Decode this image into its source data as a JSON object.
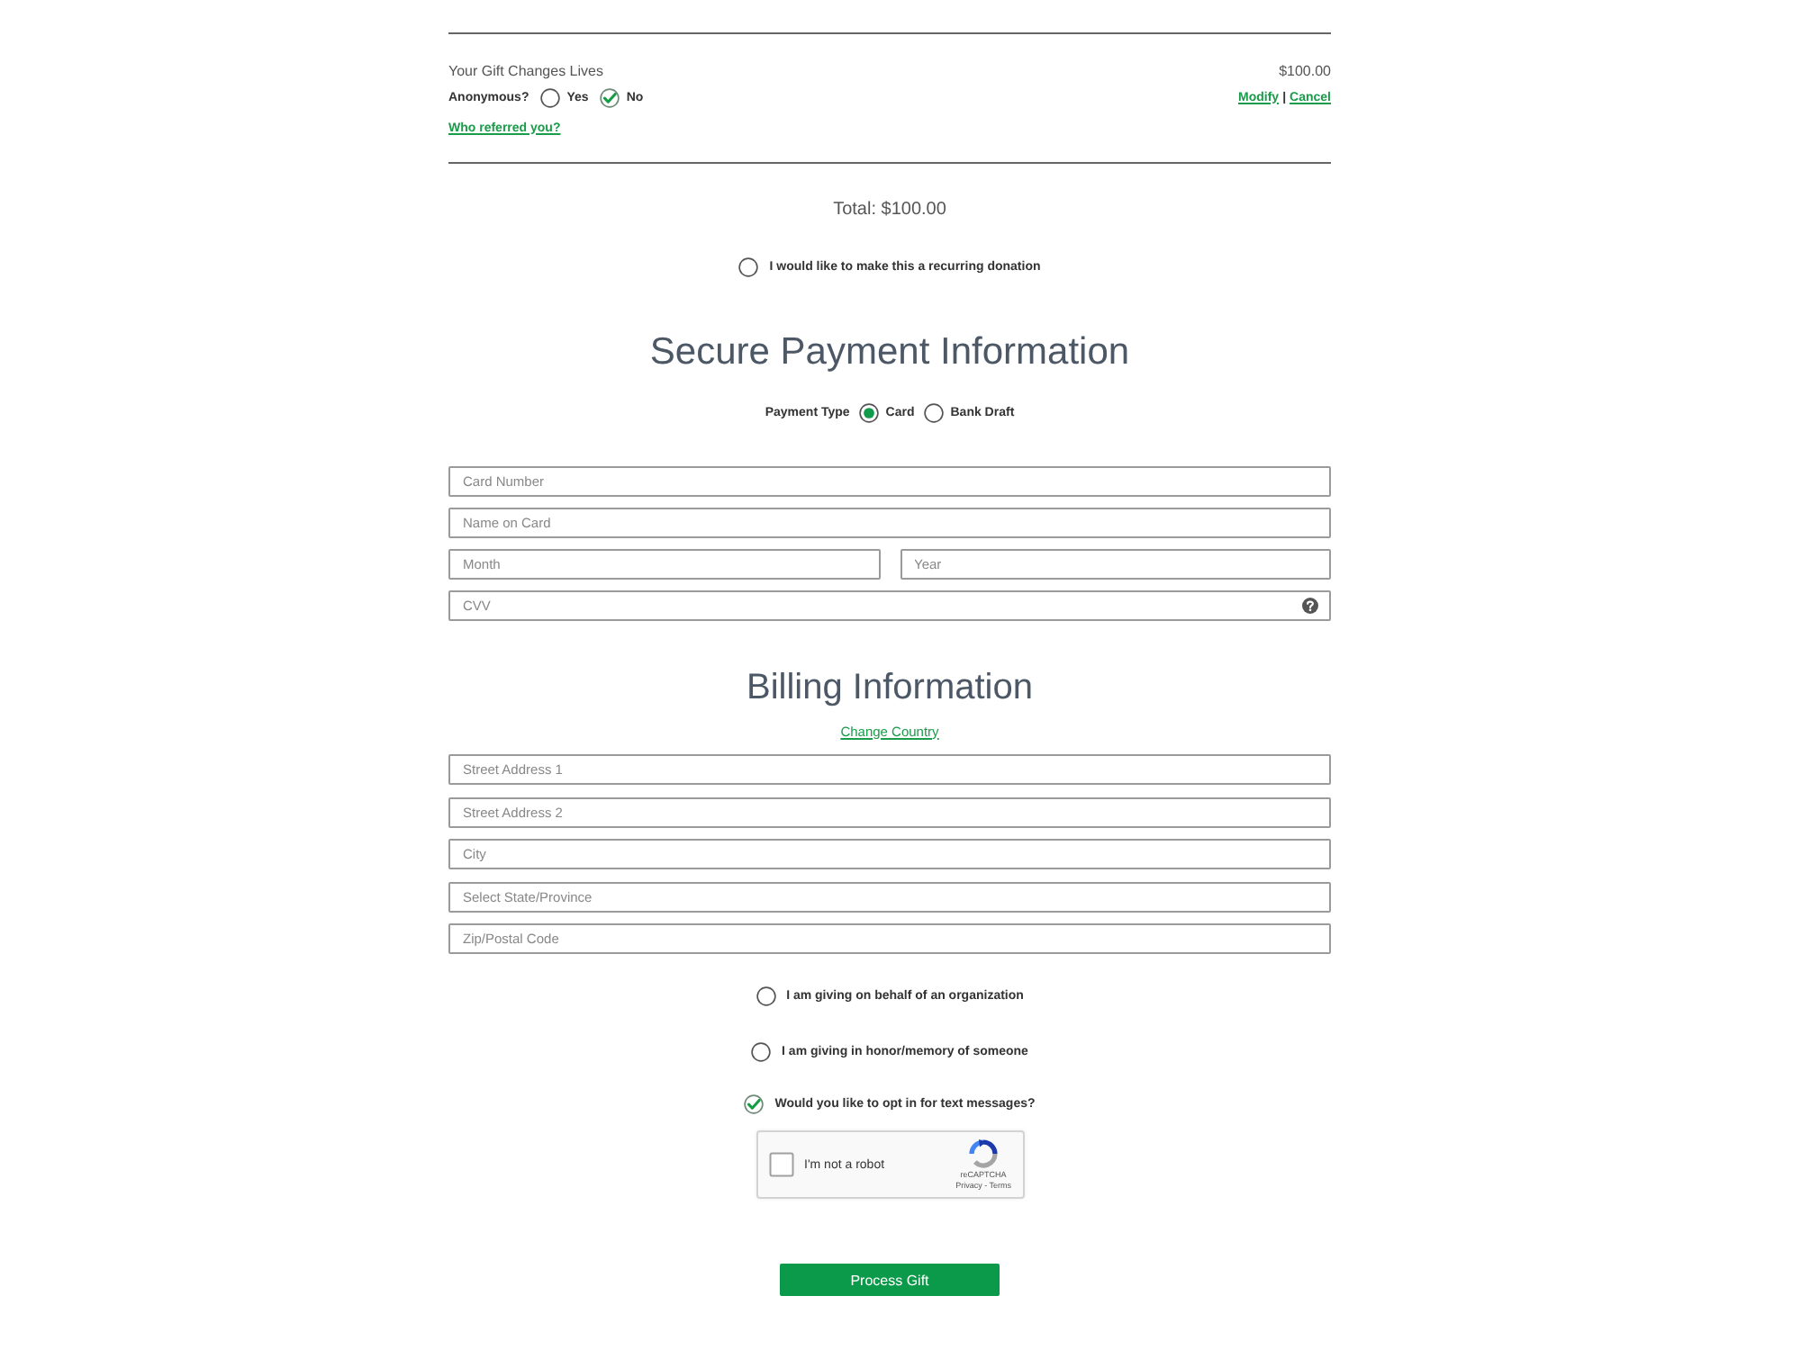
{
  "gift_summary": {
    "title": "Your Gift Changes Lives",
    "amount": "$100.00",
    "anonymous": {
      "label": "Anonymous?",
      "options": [
        {
          "label": "Yes",
          "selected": false
        },
        {
          "label": "No",
          "selected": true
        }
      ]
    },
    "actions": [
      {
        "label": "Modify"
      },
      {
        "label": "Cancel"
      }
    ],
    "actions_separator": "|",
    "referral_link": "Who referred you?"
  },
  "total": "Total: $100.00",
  "recurring": {
    "label": "I would like to make this a recurring donation",
    "checked": false
  },
  "payment": {
    "heading": "Secure Payment Information",
    "payment_type": {
      "label": "Payment Type",
      "options": [
        {
          "label": "Card",
          "selected": true
        },
        {
          "label": "Bank Draft",
          "selected": false
        }
      ]
    },
    "field_rows": [
      [
        {
          "placeholder": "Card Number"
        }
      ],
      [
        {
          "placeholder": "Name on Card"
        }
      ],
      [
        {
          "placeholder": "Month"
        },
        {
          "placeholder": "Year"
        }
      ],
      [
        {
          "placeholder": "CVV",
          "help": true
        }
      ]
    ]
  },
  "billing": {
    "heading": "Billing Information",
    "change_country_link": "Change Country",
    "fields": [
      {
        "placeholder": "Street Address 1"
      },
      {
        "placeholder": "Street Address 2"
      },
      {
        "placeholder": "City"
      },
      {
        "placeholder": "Select State/Province"
      },
      {
        "placeholder": "Zip/Postal Code"
      }
    ]
  },
  "options": [
    {
      "label": "I am giving on behalf of an organization",
      "checked": false
    },
    {
      "label": "I am giving in honor/memory of someone",
      "checked": false
    },
    {
      "label": "Would you like to opt in for text messages?",
      "checked": true
    }
  ],
  "captcha": {
    "label": "I'm not a robot",
    "checked": false,
    "brand": "reCAPTCHA",
    "footer": "Privacy - Terms"
  },
  "submit_button": "Process Gift"
}
